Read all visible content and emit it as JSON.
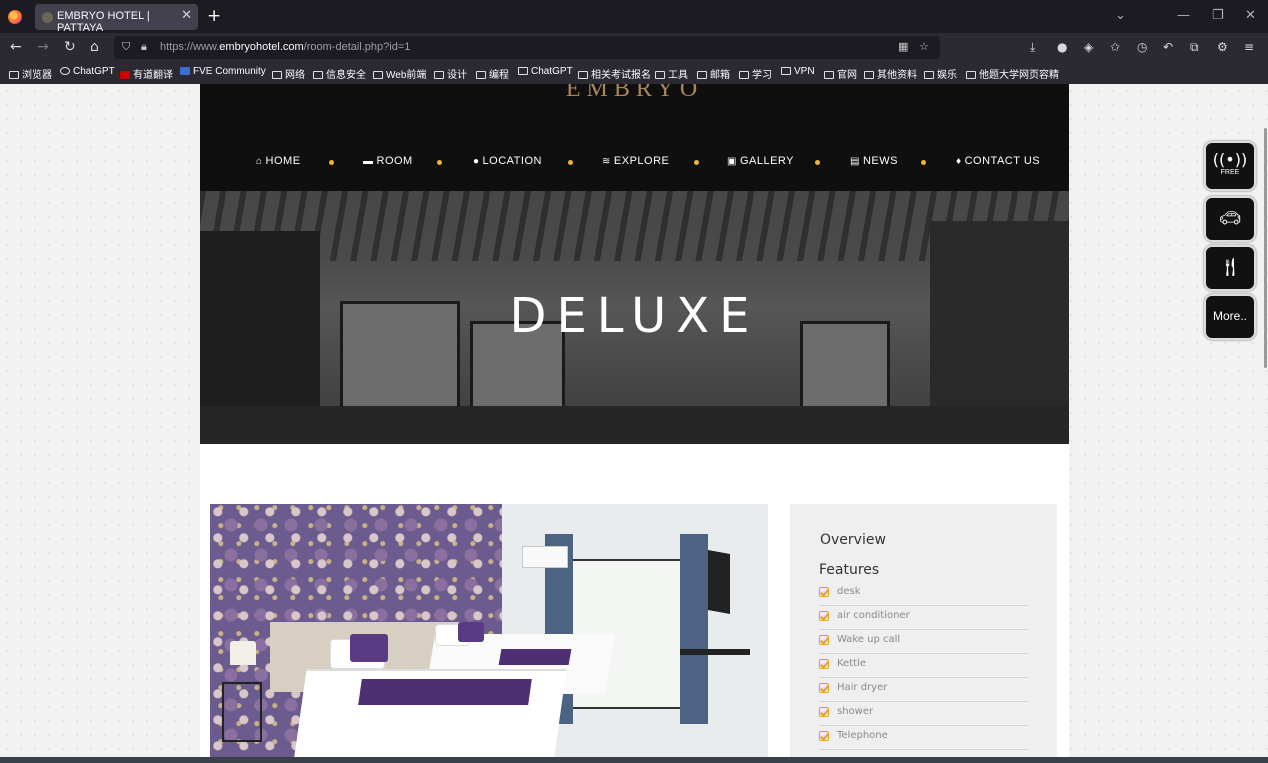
{
  "browser": {
    "tab_title": "EMBRYO HOTEL | PATTAYA",
    "url_prefix": "https://www.",
    "url_host": "embryohotel.com",
    "url_path": "/room-detail.php?id=1",
    "bookmarks": [
      "浏览器",
      "ChatGPT",
      "有道翻译",
      "FVE Community",
      "网络",
      "信息安全",
      "Web前端",
      "设计",
      "编程",
      "ChatGPT",
      "相关考试报名",
      "工具",
      "邮箱",
      "学习",
      "VPN",
      "官网",
      "其他资料",
      "娱乐",
      "他题大学网页容精"
    ]
  },
  "site": {
    "logo": "EMBRYO",
    "menu": [
      {
        "icon": "home-icon",
        "glyph": "⌂",
        "label": "HOME"
      },
      {
        "icon": "bed-icon",
        "glyph": "▬",
        "label": "ROOM"
      },
      {
        "icon": "globe-icon",
        "glyph": "●",
        "label": "LOCATION"
      },
      {
        "icon": "wifi-icon",
        "glyph": "≋",
        "label": "EXPLORE"
      },
      {
        "icon": "image-icon",
        "glyph": "▣",
        "label": "GALLERY"
      },
      {
        "icon": "newspaper-icon",
        "glyph": "▤",
        "label": "NEWS"
      },
      {
        "icon": "map-marker-icon",
        "glyph": "♦",
        "label": "CONTACT US"
      }
    ],
    "accent_color": "#f0b532"
  },
  "hero": {
    "title": "DELUXE"
  },
  "sidebar": {
    "overview": "Overview",
    "features_heading": "Features",
    "features": [
      "desk",
      "air conditioner",
      "Wake up call",
      "Kettle",
      "Hair dryer",
      "shower",
      "Telephone"
    ]
  },
  "floating": {
    "wifi_label": "FREE",
    "more_label": "More.."
  }
}
